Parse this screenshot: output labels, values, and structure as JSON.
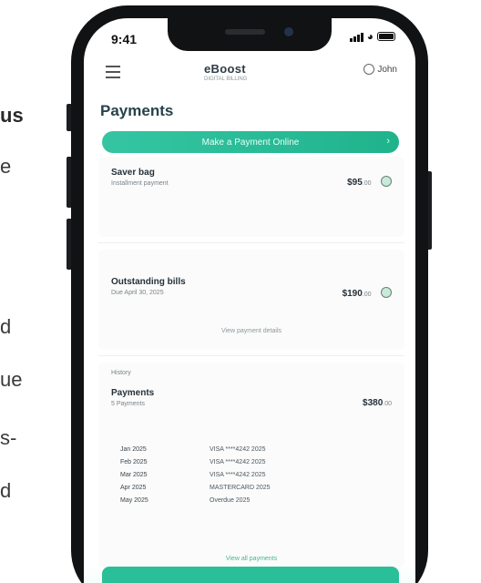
{
  "side_text": {
    "lines": [
      {
        "text": "us",
        "bold": true
      },
      {
        "text": "e",
        "bold": false
      },
      {
        "text": "d",
        "bold": false
      },
      {
        "text": "ue",
        "bold": false
      },
      {
        "text": "s-",
        "bold": false
      },
      {
        "text": "d",
        "bold": false
      }
    ]
  },
  "status_bar": {
    "time": "9:41"
  },
  "app": {
    "logo": "eBoost",
    "logo_sub": "DIGITAL BILLING",
    "profile_label": "John"
  },
  "page": {
    "title": "Payments",
    "cta_label": "Make a Payment Online"
  },
  "cards": {
    "one": {
      "title": "Saver bag",
      "subtitle": "Installment payment",
      "amount": "$95",
      "amount_unit": ".00"
    },
    "two": {
      "title": "Outstanding bills",
      "subtitle": "Due April 30, 2025",
      "amount": "$190",
      "amount_unit": ".00",
      "link": "View payment details"
    },
    "three": {
      "header": "History",
      "title": "Payments",
      "subtitle": "5 Payments",
      "amount": "$380",
      "amount_unit": ".00",
      "rows": [
        {
          "date": "Jan 2025",
          "desc": "VISA ****4242 2025",
          "mark": ""
        },
        {
          "date": "Feb 2025",
          "desc": "VISA ****4242 2025",
          "mark": ""
        },
        {
          "date": "Mar 2025",
          "desc": "VISA ****4242 2025",
          "mark": ""
        },
        {
          "date": "Apr 2025",
          "desc": "MASTERCARD 2025",
          "mark": ""
        },
        {
          "date": "May 2025",
          "desc": "Overdue 2025",
          "mark": ""
        }
      ],
      "link": "View all payments"
    }
  },
  "bottom": {
    "button_label": ""
  },
  "colors": {
    "accent": "#2bbf99",
    "accent_light": "#35c5a2",
    "frame": "#111214"
  }
}
